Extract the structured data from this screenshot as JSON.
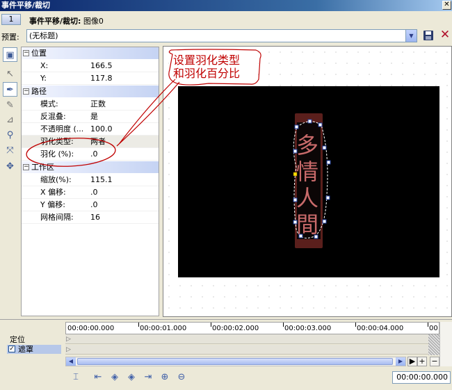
{
  "window": {
    "title": "事件平移/裁切",
    "close_glyph": "✕"
  },
  "info": {
    "track_number": "1",
    "title": "事件平移/裁切:",
    "subtitle": " 图像0"
  },
  "preset": {
    "label": "预置:",
    "value": "(无标题)"
  },
  "toolbar": {
    "save": "save-icon",
    "close": "✕"
  },
  "properties": {
    "position": {
      "header": "位置",
      "rows": [
        {
          "k": "X:",
          "v": "166.5"
        },
        {
          "k": "Y:",
          "v": "117.8"
        }
      ]
    },
    "path": {
      "header": "路径",
      "rows": [
        {
          "k": "模式:",
          "v": "正数"
        },
        {
          "k": "反混叠:",
          "v": "是"
        },
        {
          "k": "不透明度 (...",
          "v": "100.0"
        },
        {
          "k": "羽化类型:",
          "v": "两者"
        },
        {
          "k": "羽化 (%):",
          "v": ".0"
        }
      ]
    },
    "workspace": {
      "header": "工作区",
      "rows": [
        {
          "k": "缩放(%):",
          "v": "115.1"
        },
        {
          "k": "X 偏移:",
          "v": ".0"
        },
        {
          "k": "Y 偏移:",
          "v": ".0"
        },
        {
          "k": "网格间隔:",
          "v": "16"
        }
      ]
    }
  },
  "callout": {
    "line1": "设置羽化类型",
    "line2": "和羽化百分比"
  },
  "preview": {
    "glyphs": "多情人間"
  },
  "timeline": {
    "timecodes": [
      "00:00:00.000",
      "00:00:01.000",
      "00:00:02.000",
      "00:00:03.000",
      "00:00:04.000",
      "00"
    ],
    "tracks": {
      "position": "定位",
      "mask": "遮罩",
      "mask_checked": "✓"
    },
    "current_time": "00:00:00.000"
  },
  "colors": {
    "title_bar": "#0a246a",
    "callout_red": "#c00000",
    "preview_bg": "#000000"
  }
}
